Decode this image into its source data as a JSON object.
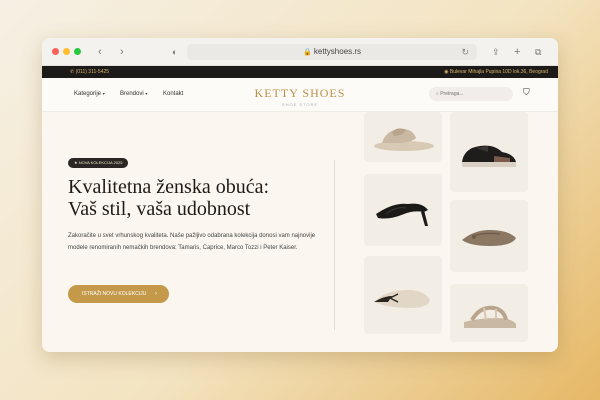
{
  "browser": {
    "url": "kettyshoes.rs",
    "back_icon": "chevron-left-icon",
    "forward_icon": "chevron-right-icon"
  },
  "topbar": {
    "phone": "(011) 311-5425",
    "address": "Bulevar Mihajla Pupina 10D lok.36, Beograd"
  },
  "nav": {
    "items": [
      "Kategorije",
      "Brendovi",
      "Kontakt"
    ],
    "logo_name": "KETTY SHOES",
    "logo_tagline": "SHOE STORE",
    "search_placeholder": "Pretraga..."
  },
  "hero": {
    "badge": "NOVA KOLEKCIJA 2025",
    "headline_line1": "Kvalitetna ženska obuća:",
    "headline_line2": "Vaš stil, vaša udobnost",
    "description": "Zakoračite u svet vrhunskog kvaliteta. Naše pažljivo odabrana kolekcija donosi vam najnovije modele renomiranih nemačkih brendova: Tamaris, Caprice, Marco Tozzi i Peter Kaiser.",
    "cta_label": "ISTRAŽI NOVU KOLEKCIJU",
    "cta_arrow": "›"
  },
  "colors": {
    "accent": "#c49a4a",
    "topbar_bg": "#1d1b19",
    "topbar_text": "#d8b46a"
  },
  "products": [
    {
      "name": "beige-slide-sandal-image"
    },
    {
      "name": "black-sneaker-image"
    },
    {
      "name": "black-heeled-mule-image"
    },
    {
      "name": "taupe-ballet-flat-image"
    },
    {
      "name": "beige-pointed-flat-image"
    },
    {
      "name": "beige-sport-sandal-image"
    }
  ]
}
